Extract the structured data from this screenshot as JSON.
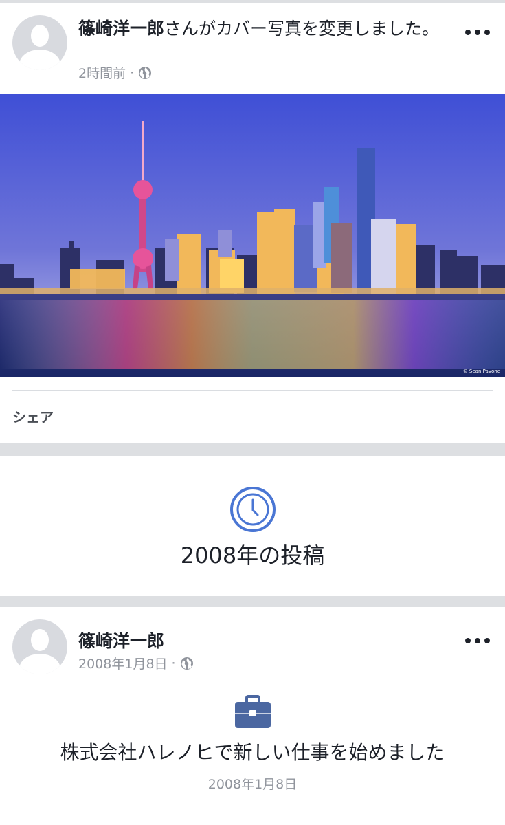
{
  "post1": {
    "author": "篠崎洋一郎",
    "action": "さんがカバー写真を変更しました。",
    "time": "2時間前",
    "separator": "·",
    "privacy_icon": "globe-icon",
    "more_icon": "more-options-icon",
    "photo_credit": "© Sean Pavone",
    "share_label": "シェア"
  },
  "year_section": {
    "icon": "clock-icon",
    "title": "2008年の投稿",
    "accent_color": "#4a76d4"
  },
  "post2": {
    "author": "篠崎洋一郎",
    "time": "2008年1月8日",
    "separator": "·",
    "privacy_icon": "globe-icon",
    "more_icon": "more-options-icon",
    "event_icon": "briefcase-icon",
    "event_text": "株式会社ハレノヒで新しい仕事を始めました",
    "event_date": "2008年1月8日",
    "event_icon_color": "#4b67a1"
  }
}
